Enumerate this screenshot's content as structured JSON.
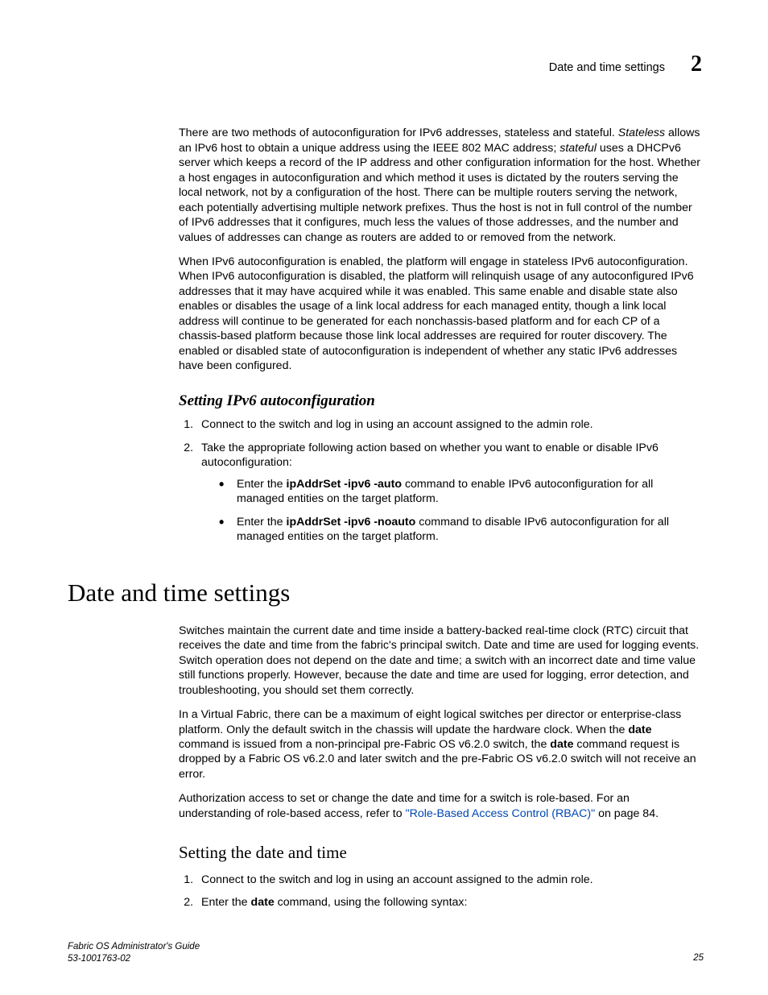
{
  "header": {
    "running_title": "Date and time settings",
    "chapter_number": "2"
  },
  "intro": {
    "p1_a": "There are two methods of autoconfiguration for IPv6 addresses, stateless and stateful. ",
    "p1_stateless": "Stateless",
    "p1_b": " allows an IPv6 host to obtain a unique address using the IEEE 802 MAC address; ",
    "p1_stateful": "stateful",
    "p1_c": " uses a DHCPv6 server which keeps a record of the IP address and other configuration information for the host. Whether a host engages in autoconfiguration and which method it uses is dictated by the routers serving the local network, not by a configuration of the host. There can be multiple routers serving the network, each potentially advertising multiple network prefixes. Thus the host is not in full control of the number of IPv6 addresses that it configures, much less the values of those addresses, and the number and values of addresses can change as routers are added to or removed from the network.",
    "p2": "When IPv6 autoconfiguration is enabled, the platform will engage in stateless IPv6 autoconfiguration. When IPv6 autoconfiguration is disabled, the platform will relinquish usage of any autoconfigured IPv6 addresses that it may have acquired while it was enabled. This same enable and disable state also enables or disables the usage of a link local address for each managed entity, though a link local address will continue to be generated for each nonchassis-based platform and for each CP of a chassis-based platform because those link local addresses are required for router discovery. The enabled or disabled state of autoconfiguration is independent of whether any static IPv6 addresses have been configured."
  },
  "section_ipv6": {
    "heading": "Setting IPv6 autoconfiguration",
    "steps": {
      "s1": "Connect to the switch and log in using an account assigned to the admin role.",
      "s2": "Take the appropriate following action based on whether you want to enable or disable IPv6 autoconfiguration:",
      "b1_a": "Enter the ",
      "b1_cmd": "ipAddrSet -ipv6 -auto",
      "b1_b": " command to enable IPv6 autoconfiguration for all managed entities on the target platform.",
      "b2_a": "Enter the ",
      "b2_cmd": "ipAddrSet -ipv6 -noauto",
      "b2_b": " command to disable IPv6 autoconfiguration for all managed entities on the target platform."
    }
  },
  "section_datetime": {
    "heading": "Date and time settings",
    "p1": "Switches maintain the current date and time inside a battery-backed real-time clock (RTC) circuit that receives the date and time from the fabric's principal switch. Date and time are used for logging events. Switch operation does not depend on the date and time; a switch with an incorrect date and time value still functions properly. However, because the date and time are used for logging, error detection, and troubleshooting, you should set them correctly.",
    "p2_a": "In a Virtual Fabric, there can be a maximum of eight logical switches per director or enterprise-class platform. Only the default switch in the chassis will update the hardware clock. When the ",
    "p2_cmd1": "date",
    "p2_b": " command is issued from a non-principal pre-Fabric OS v6.2.0 switch, the ",
    "p2_cmd2": "date",
    "p2_c": " command request is dropped by a Fabric OS v6.2.0 and later switch and the pre-Fabric OS v6.2.0 switch will not receive an error.",
    "p3_a": "Authorization access to set or change the date and time for a switch is role-based. For an understanding of role-based access, refer to ",
    "p3_link": "\"Role-Based Access Control (RBAC)\"",
    "p3_b": " on page 84."
  },
  "section_setdate": {
    "heading": "Setting the date and time",
    "steps": {
      "s1": "Connect to the switch and log in using an account assigned to the admin role.",
      "s2_a": "Enter the ",
      "s2_cmd": "date",
      "s2_b": " command, using the following syntax:"
    }
  },
  "footer": {
    "doc_title": "Fabric OS Administrator's Guide",
    "doc_number": "53-1001763-02",
    "page_number": "25"
  }
}
